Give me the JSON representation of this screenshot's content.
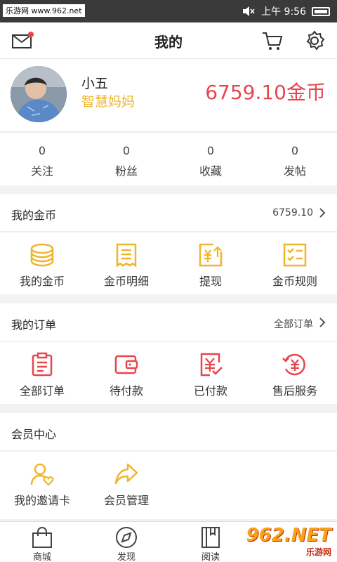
{
  "status_bar": {
    "watermark": "乐游网 www.962.net",
    "time_label": "上午 9:56"
  },
  "header": {
    "title": "我的"
  },
  "profile": {
    "name": "小五",
    "role": "智慧妈妈",
    "coins": "6759.10金币"
  },
  "stats": [
    {
      "value": "0",
      "label": "关注"
    },
    {
      "value": "0",
      "label": "粉丝"
    },
    {
      "value": "0",
      "label": "收藏"
    },
    {
      "value": "0",
      "label": "发帖"
    }
  ],
  "coins_section": {
    "title": "我的金币",
    "value": "6759.10",
    "items": [
      {
        "label": "我的金币",
        "icon": "coin-stack-icon"
      },
      {
        "label": "金币明细",
        "icon": "receipt-icon"
      },
      {
        "label": "提现",
        "icon": "withdraw-icon"
      },
      {
        "label": "金币规则",
        "icon": "rules-list-icon"
      }
    ]
  },
  "orders_section": {
    "title": "我的订单",
    "all_label": "全部订单",
    "items": [
      {
        "label": "全部订单",
        "icon": "clipboard-icon"
      },
      {
        "label": "待付款",
        "icon": "wallet-icon"
      },
      {
        "label": "已付款",
        "icon": "paid-check-icon"
      },
      {
        "label": "售后服务",
        "icon": "refund-icon"
      }
    ]
  },
  "member_section": {
    "title": "会员中心",
    "items": [
      {
        "label": "我的邀请卡",
        "icon": "invite-user-icon"
      },
      {
        "label": "会员管理",
        "icon": "share-arrow-icon"
      }
    ]
  },
  "tabbar": [
    {
      "label": "商城",
      "icon": "shopping-bag-icon"
    },
    {
      "label": "发现",
      "icon": "compass-icon"
    },
    {
      "label": "阅读",
      "icon": "book-icon"
    }
  ],
  "brand": {
    "main": "962.NET",
    "sub": "乐游网"
  },
  "colors": {
    "gold": "#f0b429",
    "red": "#e8454e"
  }
}
